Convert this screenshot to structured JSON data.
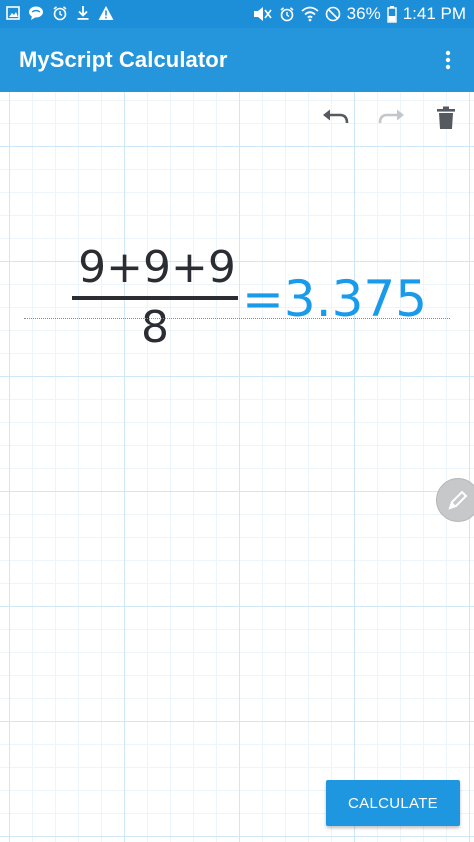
{
  "status_bar": {
    "battery": "36%",
    "time": "1:41 PM",
    "left_icons": [
      "image-icon",
      "chat-bubble-icon",
      "alarm-icon",
      "download-icon",
      "warning-icon"
    ],
    "right_icons": [
      "mute-icon",
      "alarm-icon",
      "wifi-icon",
      "do-not-disturb-icon",
      "battery-icon"
    ]
  },
  "app_bar": {
    "title": "MyScript Calculator",
    "menu_icon": "more-vert-icon"
  },
  "toolbar": {
    "undo_icon": "undo-icon",
    "redo_icon": "redo-icon",
    "clear_icon": "trash-icon"
  },
  "expression": {
    "numerator": "9+9+9",
    "denominator": "8",
    "result": "=3.375"
  },
  "pen_button": {
    "icon": "pencil-icon"
  },
  "calculate_button": {
    "label": "CALCULATE"
  },
  "colors": {
    "status_bar": "#1d8fd9",
    "app_bar": "#2596dc",
    "result": "#1a9bea",
    "ink": "#2b2d33",
    "grid": "#cfe7f7"
  }
}
